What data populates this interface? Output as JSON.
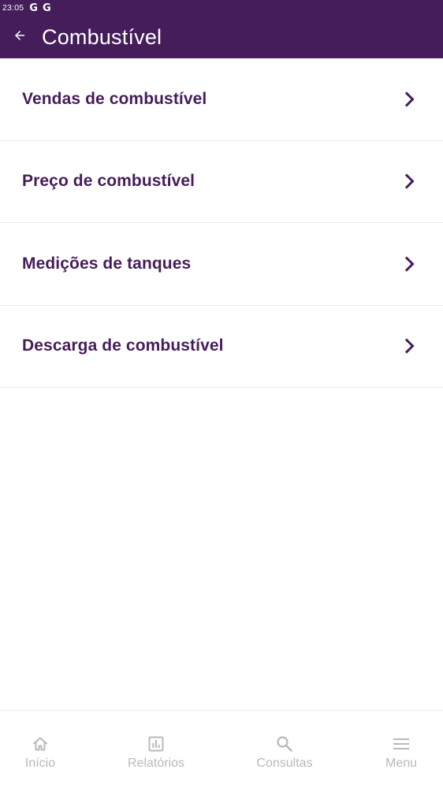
{
  "status_bar": {
    "time": "23:05",
    "notification_icons": [
      "G",
      "G"
    ]
  },
  "app_bar": {
    "back_icon": "arrow-left-icon",
    "title": "Combustível"
  },
  "menu_items": [
    {
      "label": "Vendas de combustível",
      "icon": "chevron-right-icon"
    },
    {
      "label": "Preço de combustível",
      "icon": "chevron-right-icon"
    },
    {
      "label": "Medições de tanques",
      "icon": "chevron-right-icon"
    },
    {
      "label": "Descarga de combustível",
      "icon": "chevron-right-icon"
    }
  ],
  "bottom_nav": [
    {
      "label": "Início",
      "icon": "home-icon"
    },
    {
      "label": "Relatórios",
      "icon": "bar-chart-icon"
    },
    {
      "label": "Consultas",
      "icon": "search-icon"
    },
    {
      "label": "Menu",
      "icon": "hamburger-menu-icon"
    }
  ],
  "colors": {
    "brand": "#451D5A",
    "nav_inactive": "#B9B9B9",
    "divider": "#ECECEC"
  }
}
